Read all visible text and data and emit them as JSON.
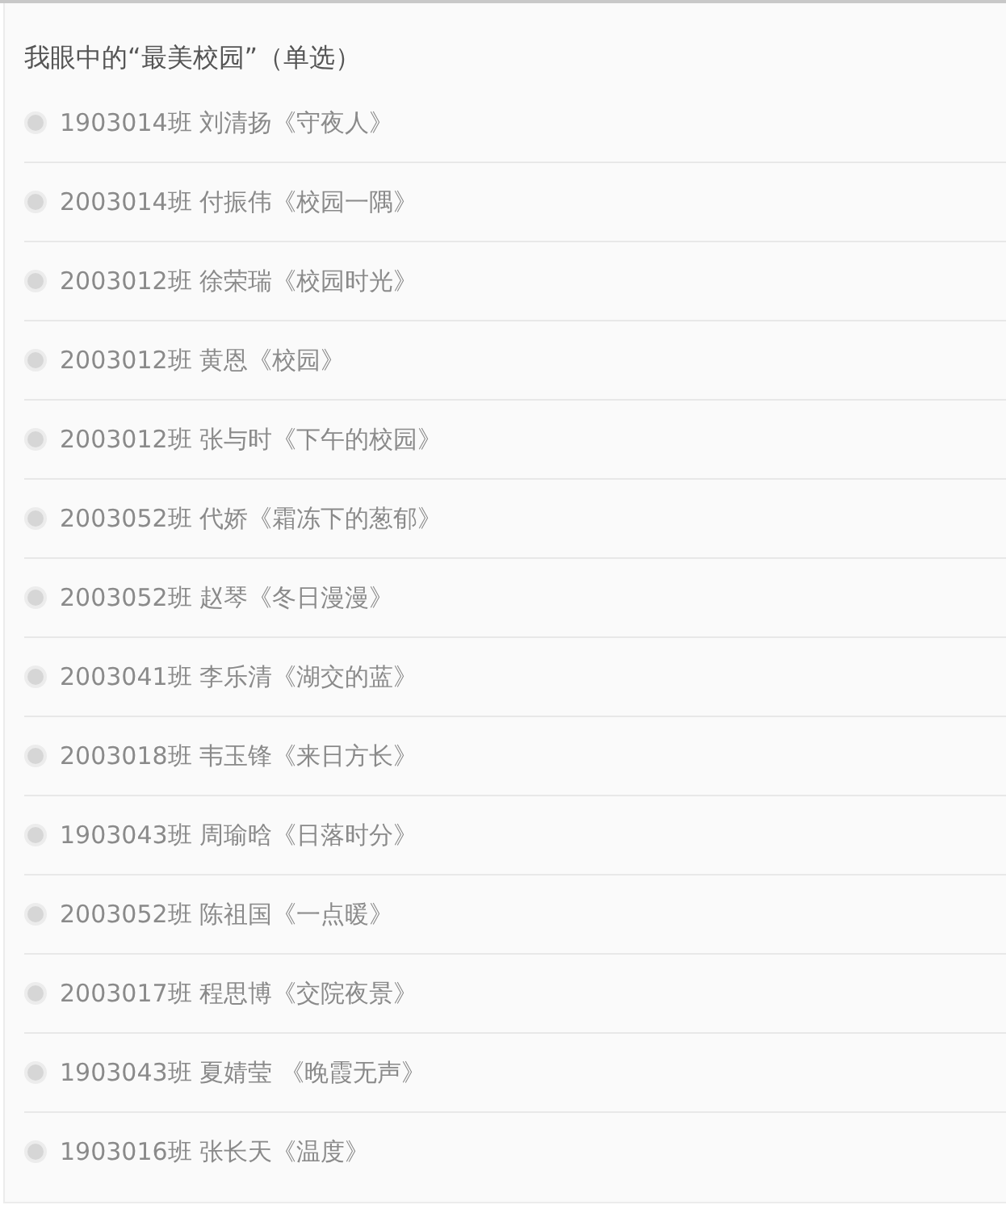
{
  "question": {
    "title": "我眼中的“最美校园”（单选）"
  },
  "options": [
    {
      "label": "1903014班 刘清扬《守夜人》",
      "selected": false,
      "disabled": true
    },
    {
      "label": "2003014班 付振伟《校园一隅》",
      "selected": false,
      "disabled": true
    },
    {
      "label": "2003012班 徐荣瑞《校园时光》",
      "selected": false,
      "disabled": true
    },
    {
      "label": "2003012班 黄恩《校园》",
      "selected": false,
      "disabled": true
    },
    {
      "label": "2003012班 张与时《下午的校园》",
      "selected": false,
      "disabled": true
    },
    {
      "label": "2003052班 代娇《霜冻下的葱郁》",
      "selected": false,
      "disabled": true
    },
    {
      "label": "2003052班 赵琴《冬日漫漫》",
      "selected": false,
      "disabled": true
    },
    {
      "label": "2003041班 李乐清《湖交的蓝》",
      "selected": false,
      "disabled": true
    },
    {
      "label": "2003018班 韦玉锋《来日方长》",
      "selected": false,
      "disabled": true
    },
    {
      "label": "1903043班 周瑜晗《日落时分》",
      "selected": false,
      "disabled": true
    },
    {
      "label": "2003052班 陈祖国《一点暖》",
      "selected": false,
      "disabled": true
    },
    {
      "label": "2003017班 程思博《交院夜景》",
      "selected": false,
      "disabled": true
    },
    {
      "label": "1903043班 夏婧莹 《晚霞无声》",
      "selected": false,
      "disabled": true
    },
    {
      "label": "1903016班 张长天《温度》",
      "selected": false,
      "disabled": true
    }
  ]
}
